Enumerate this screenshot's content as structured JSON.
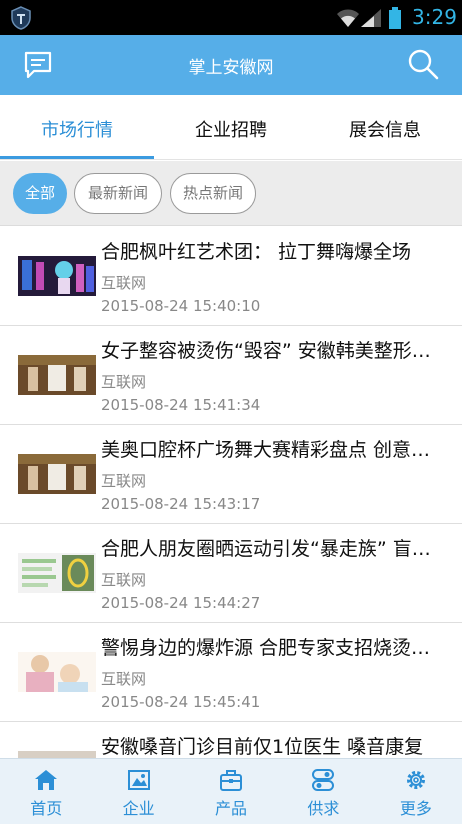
{
  "status": {
    "time": "3:29"
  },
  "header": {
    "title": "掌上安徽网",
    "left_icon": "message-icon",
    "right_icon": "search-icon"
  },
  "tabs": [
    {
      "label": "市场行情",
      "active": true
    },
    {
      "label": "企业招聘",
      "active": false
    },
    {
      "label": "展会信息",
      "active": false
    }
  ],
  "filters": [
    {
      "label": "全部",
      "active": true
    },
    {
      "label": "最新新闻",
      "active": false
    },
    {
      "label": "热点新闻",
      "active": false
    }
  ],
  "news": [
    {
      "title": "合肥枫叶红艺术团： 拉丁舞嗨爆全场",
      "source": "互联网",
      "datetime": "2015-08-24 15:40:10"
    },
    {
      "title": "女子整容被烫伤“毁容” 安徽韩美整形医院",
      "source": "互联网",
      "datetime": "2015-08-24 15:41:34"
    },
    {
      "title": "美奥口腔杯广场舞大赛精彩盘点 创意十足",
      "source": "互联网",
      "datetime": "2015-08-24 15:43:17"
    },
    {
      "title": "合肥人朋友圈晒运动引发“暴走族” 盲目运动",
      "source": "互联网",
      "datetime": "2015-08-24 15:44:27"
    },
    {
      "title": "警惕身边的爆炸源 合肥专家支招烧烫伤处理",
      "source": "互联网",
      "datetime": "2015-08-24 15:45:41"
    },
    {
      "title": "安徽嗓音门诊目前仅1位医生 嗓音康复",
      "source": "",
      "datetime": ""
    }
  ],
  "bottom_nav": [
    {
      "label": "首页",
      "icon": "home-icon"
    },
    {
      "label": "企业",
      "icon": "enterprise-icon"
    },
    {
      "label": "产品",
      "icon": "product-icon"
    },
    {
      "label": "供求",
      "icon": "supply-demand-icon"
    },
    {
      "label": "更多",
      "icon": "settings-icon"
    }
  ],
  "colors": {
    "accent": "#56aee8",
    "active_text": "#2c8fd6",
    "status_time": "#33b5e5"
  }
}
